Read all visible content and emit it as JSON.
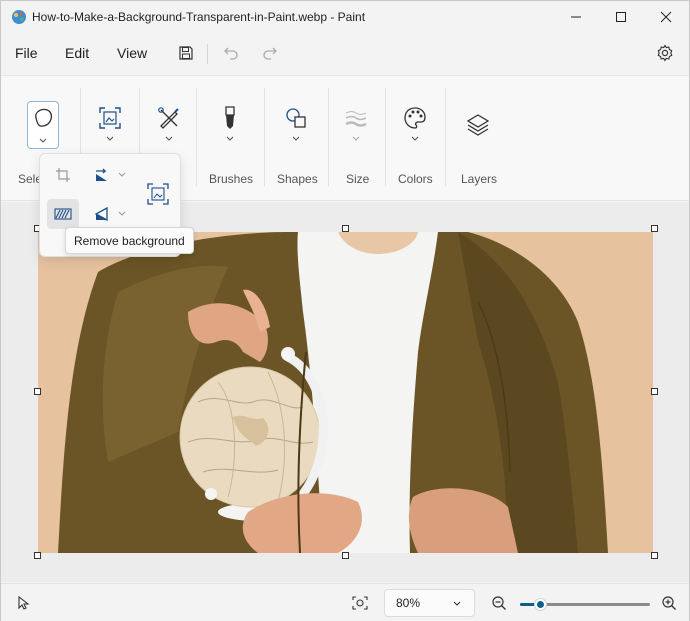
{
  "window": {
    "title": "How-to-Make-a-Background-Transparent-in-Paint.webp - Paint",
    "controls": [
      "minimize-icon",
      "maximize-icon",
      "close-icon"
    ]
  },
  "menu": {
    "items": [
      {
        "label": "File"
      },
      {
        "label": "Edit"
      },
      {
        "label": "View"
      }
    ],
    "icons": [
      "save-icon",
      "undo-icon",
      "redo-icon",
      "settings-icon"
    ]
  },
  "ribbon": {
    "groups": [
      {
        "label": "Sele",
        "icon": "lasso-select-icon"
      },
      {
        "label": "",
        "icon": "image-resize-icon"
      },
      {
        "label": "",
        "icon": "tools-icon"
      },
      {
        "label": "Brushes",
        "icon": "brush-icon"
      },
      {
        "label": "Shapes",
        "icon": "shapes-icon"
      },
      {
        "label": "Size",
        "icon": "line-size-icon"
      },
      {
        "label": "Colors",
        "icon": "palette-icon"
      },
      {
        "label": "Layers",
        "icon": "layers-icon"
      }
    ]
  },
  "image_popup": {
    "tools": [
      "crop-icon",
      "rotate-icon",
      "remove-background-icon",
      "flip-icon",
      "image-resize-icon"
    ],
    "tooltip": "Remove background"
  },
  "status": {
    "zoom": "80%",
    "zoom_fraction": 0.15,
    "icons": [
      "pointer-icon",
      "fit-to-window-icon",
      "zoom-out-icon",
      "zoom-in-icon"
    ]
  },
  "colors": {
    "accent": "#0f5f86",
    "background_beige": "#e6c29f",
    "jacket": "#6b5526",
    "shirt": "#f4f4f2"
  }
}
